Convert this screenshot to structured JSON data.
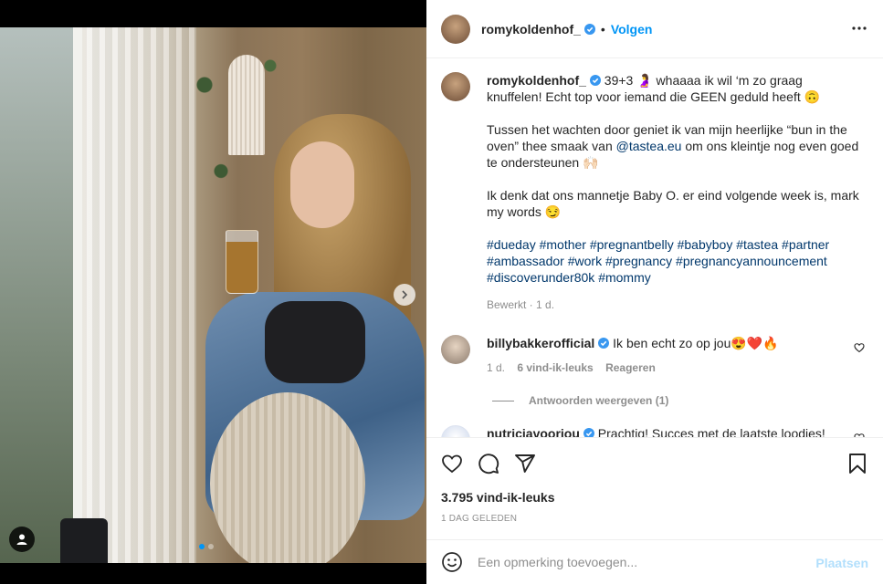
{
  "post": {
    "username": "romykoldenhof_",
    "follow_label": "Volgen",
    "separator": "•",
    "caption": {
      "line1": "39+3 🤰 whaaaa ik wil ‘m zo graag knuffelen! Echt top voor iemand die GEEN geduld heeft 🙃",
      "line2_before": "Tussen het wachten door geniet ik van mijn heerlijke “bun in the oven” thee smaak van ",
      "mention": "@tastea.eu",
      "line2_after": " om ons kleintje nog even goed te ondersteunen 🙌🏻",
      "line3": "Ik denk dat ons mannetje Baby O. er eind volgende week is, mark my words 😏",
      "hashtags": [
        "#dueday",
        "#mother",
        "#pregnantbelly",
        "#babyboy",
        "#tastea",
        "#partner",
        "#ambassador",
        "#work",
        "#pregnancy",
        "#pregnancyannouncement",
        "#discoverunder80k",
        "#mommy"
      ],
      "meta": "Bewerkt · 1 d."
    },
    "comments": [
      {
        "username": "billybakkerofficial",
        "text": "Ik ben echt zo op jou😍❤️🔥",
        "time": "1 d.",
        "likes": "6 vind-ik-leuks",
        "reply_label": "Reageren",
        "replies_label": "Antwoorden weergeven (1)"
      },
      {
        "username": "nutriciavoorjou",
        "text": "Prachtig! Succes met de laatste loodjes!"
      }
    ],
    "likes_label": "3.795 vind-ik-leuks",
    "date_label": "1 DAG GELEDEN",
    "add_comment_placeholder": "Een opmerking toevoegen...",
    "post_button": "Plaatsen"
  },
  "carousel": {
    "slides": 2,
    "active": 1
  },
  "icons": [
    "verified-icon",
    "more-icon",
    "heart-icon",
    "comment-icon",
    "share-icon",
    "bookmark-icon",
    "emoji-icon",
    "next-arrow-icon",
    "user-tag-icon"
  ],
  "colors": {
    "accent": "#0095f6",
    "link": "#00376b",
    "muted": "#8e8e8e",
    "text": "#262626"
  }
}
